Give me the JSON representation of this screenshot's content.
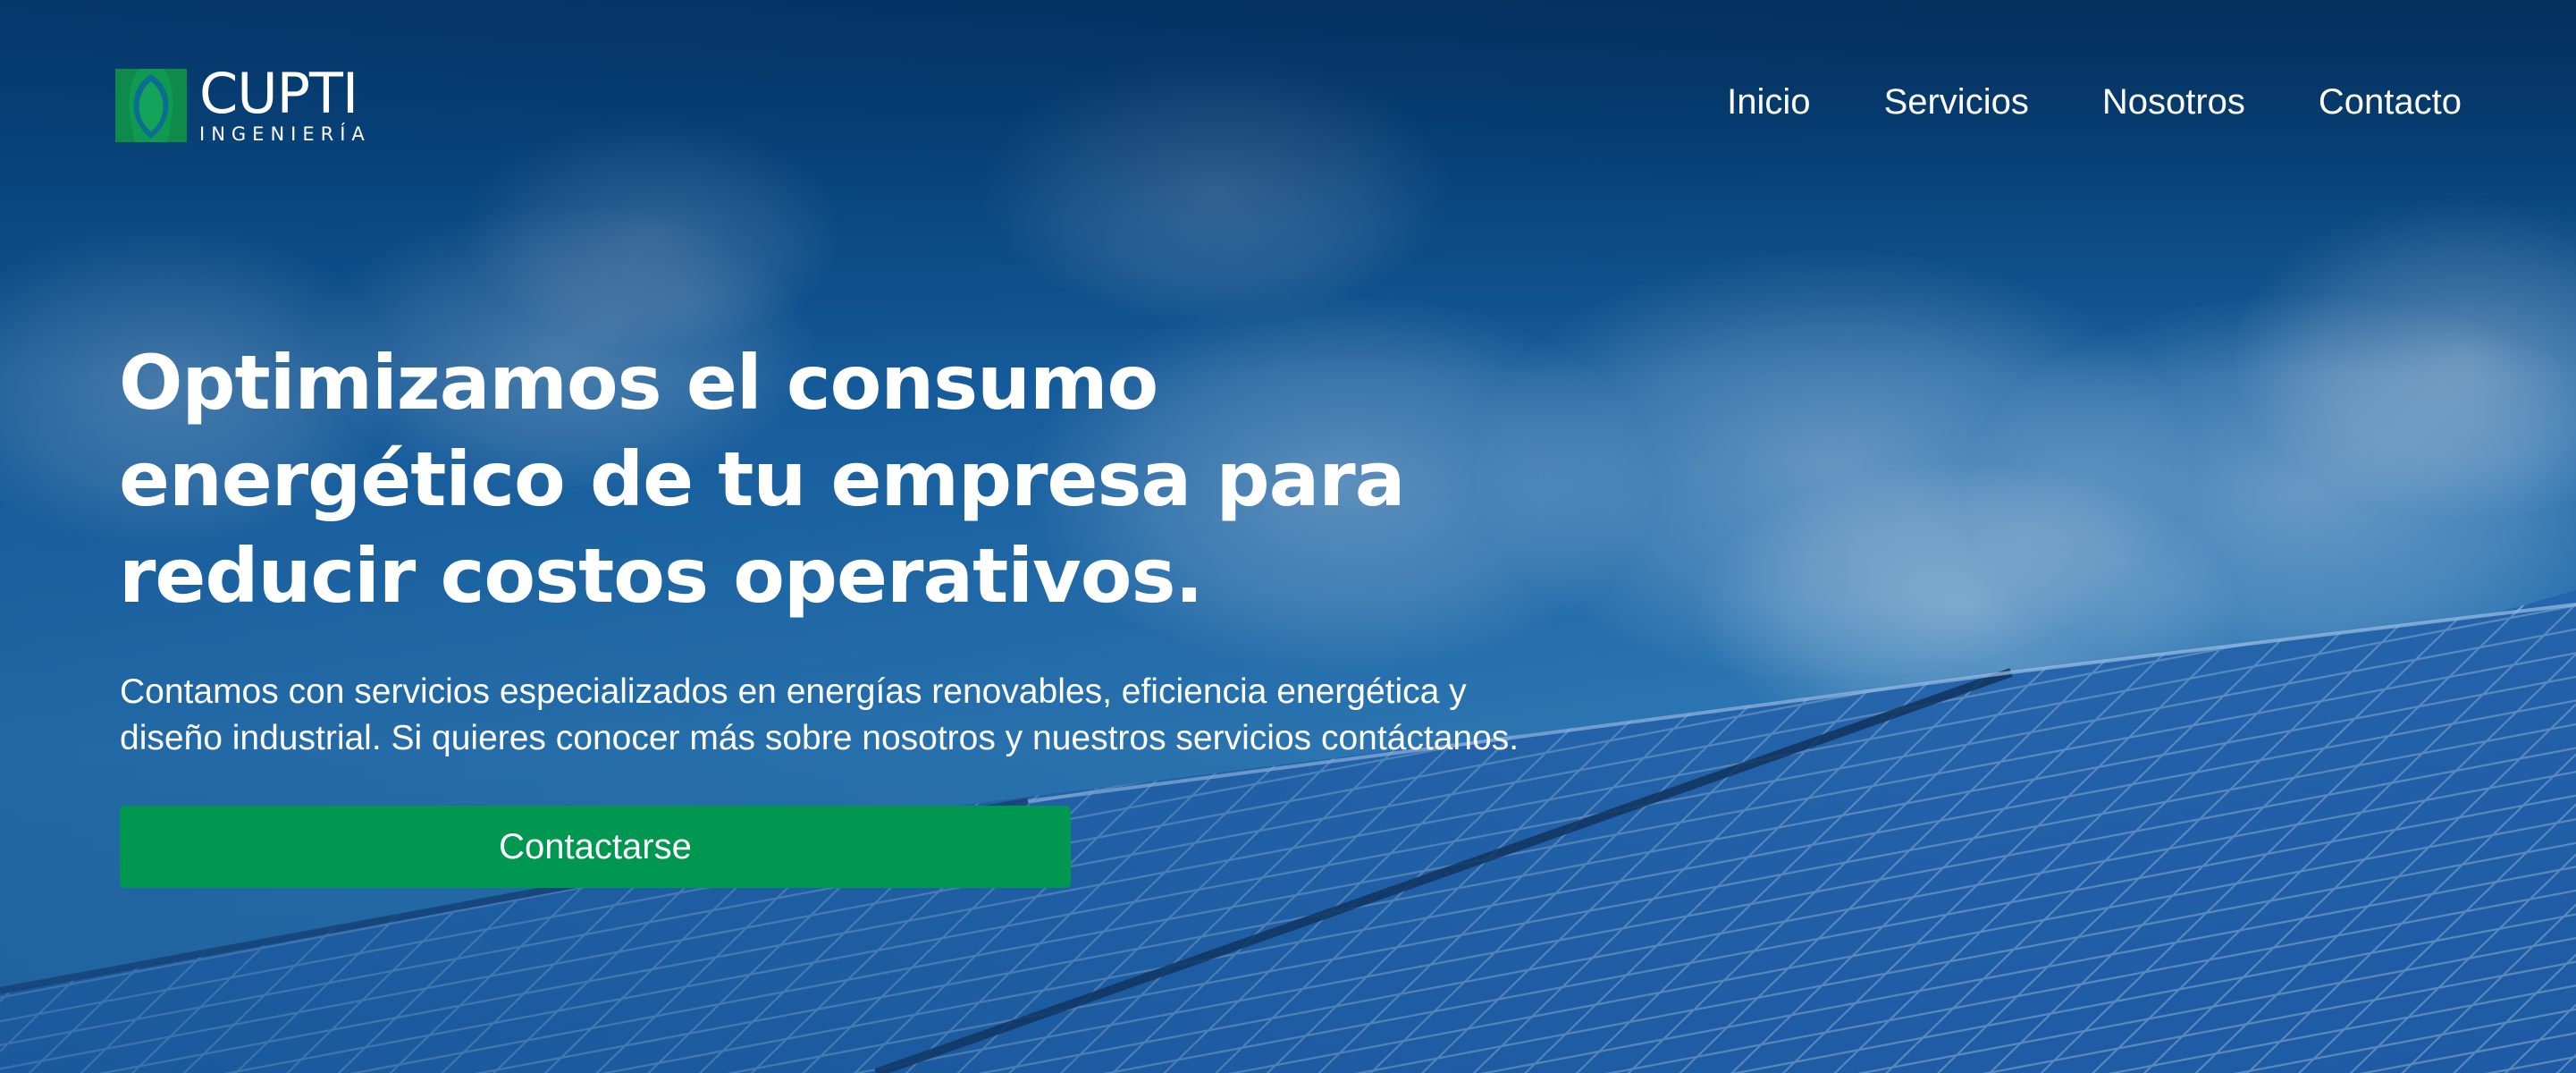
{
  "brand": {
    "name": "CUPTI",
    "subtitle": "INGENIERÍA",
    "logo_icon": "leaf-logo-icon",
    "accent_color": "#009850"
  },
  "nav": {
    "items": [
      {
        "label": "Inicio"
      },
      {
        "label": "Servicios"
      },
      {
        "label": "Nosotros"
      },
      {
        "label": "Contacto"
      }
    ]
  },
  "hero": {
    "headline_lines": [
      "Optimizamos el consumo",
      "energético de tu empresa para",
      "reducir costos operativos."
    ],
    "description_lines": [
      "Contamos con servicios especializados en energías renovables, eficiencia energética y",
      "diseño industrial.  Si quieres conocer más sobre nosotros y nuestros servicios contáctanos."
    ],
    "cta_label": "Contactarse",
    "background": "solar-panels-sky-image"
  }
}
